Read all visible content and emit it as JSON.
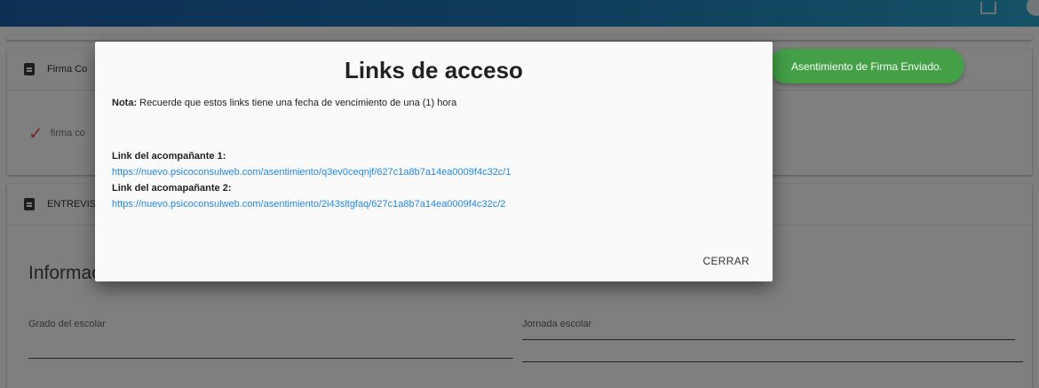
{
  "cards": {
    "firma_title": "Firma Co",
    "firma_check_text": "firma co",
    "entrevista_title": "ENTREVIS",
    "info_title": "Informac",
    "grado_label": "Grado del escolar",
    "jornada_label": "Jornada escolar"
  },
  "toast": {
    "text": "Asentimiento de Firma Enviado."
  },
  "modal": {
    "title": "Links de acceso",
    "note_prefix": "Nota:",
    "note_text": "Recuerde que estos links tiene una fecha de vencimiento de una (1) hora",
    "link1_label": "Link del acompañante 1:",
    "link1_url": "https://nuevo.psicoconsulweb.com/asentimiento/q3ev0ceqnjf/627c1a8b7a14ea0009f4c32c/1",
    "link2_label": "Link del acomapañante 2:",
    "link2_url": "https://nuevo.psicoconsulweb.com/asentimiento/2i43sltgfaq/627c1a8b7a14ea0009f4c32c/2",
    "close_label": "CERRAR"
  },
  "colors": {
    "toast_bg": "#43a047",
    "link": "#1e88e5",
    "header_start": "#1d5fa8",
    "header_end": "#2aa6cf"
  }
}
